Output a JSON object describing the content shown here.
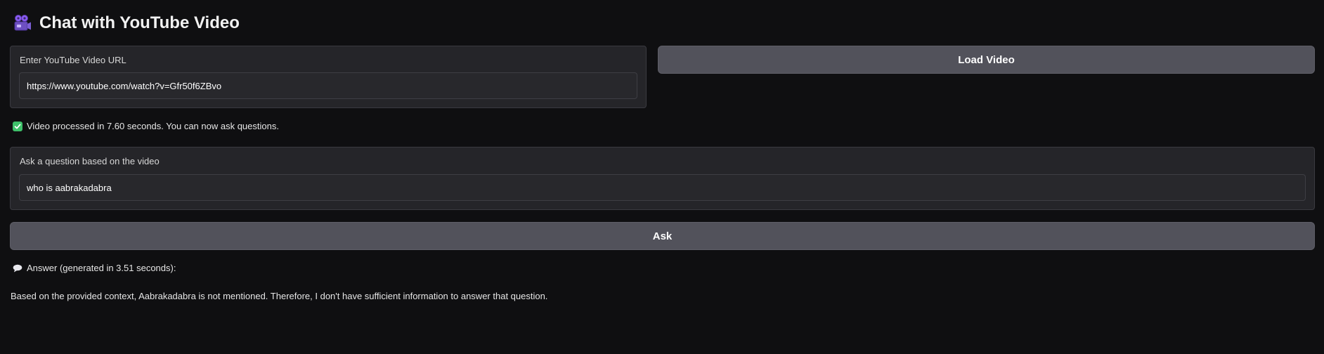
{
  "header": {
    "title": "Chat with YouTube Video",
    "icon": "movie-camera-icon"
  },
  "url_panel": {
    "label": "Enter YouTube Video URL",
    "value": "https://www.youtube.com/watch?v=Gfr50f6ZBvo",
    "placeholder": ""
  },
  "load_button": {
    "label": "Load Video"
  },
  "status": {
    "icon": "check-mark-icon",
    "text": "Video processed in 7.60 seconds. You can now ask questions."
  },
  "question_panel": {
    "label": "Ask a question based on the video",
    "value": "who is aabrakadabra",
    "placeholder": ""
  },
  "ask_button": {
    "label": "Ask"
  },
  "answer": {
    "icon": "speech-bubble-icon",
    "heading": "Answer (generated in 3.51 seconds):",
    "text": "Based on the provided context, Aabrakadabra is not mentioned. Therefore, I don't have sufficient information to answer that question."
  },
  "colors": {
    "background": "#0f0f11",
    "panel": "#252529",
    "button": "#52525b",
    "success": "#3ec06a"
  }
}
